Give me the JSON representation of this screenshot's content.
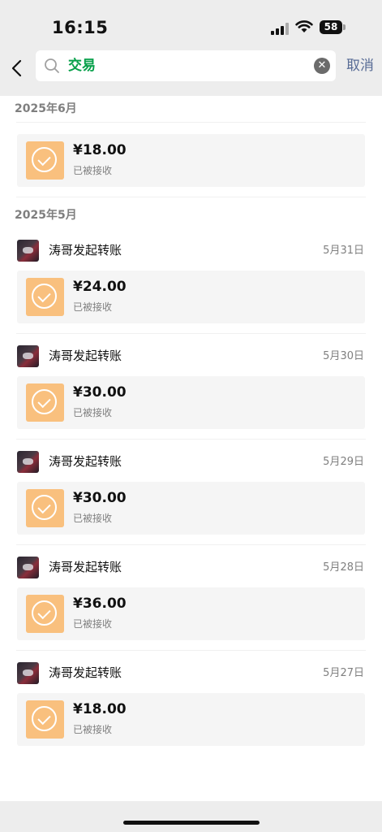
{
  "status_bar": {
    "time": "16:15",
    "battery": "58"
  },
  "search": {
    "query": "交易",
    "cancel_label": "取消"
  },
  "sections": [
    {
      "month": "2025年6月",
      "items": [
        {
          "title": "",
          "date": "",
          "amount": "¥18.00",
          "status": "已被接收"
        }
      ]
    },
    {
      "month": "2025年5月",
      "items": [
        {
          "title": "涛哥发起转账",
          "date": "5月31日",
          "amount": "¥24.00",
          "status": "已被接收"
        },
        {
          "title": "涛哥发起转账",
          "date": "5月30日",
          "amount": "¥30.00",
          "status": "已被接收"
        },
        {
          "title": "涛哥发起转账",
          "date": "5月29日",
          "amount": "¥30.00",
          "status": "已被接收"
        },
        {
          "title": "涛哥发起转账",
          "date": "5月28日",
          "amount": "¥36.00",
          "status": "已被接收"
        },
        {
          "title": "涛哥发起转账",
          "date": "5月27日",
          "amount": "¥18.00",
          "status": "已被接收"
        }
      ]
    }
  ]
}
